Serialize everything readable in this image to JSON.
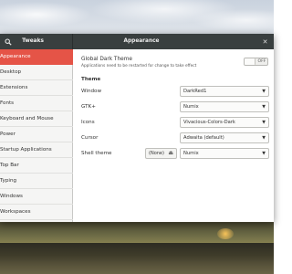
{
  "header": {
    "app_title": "Tweaks",
    "page_title": "Appearance",
    "icons": {
      "search": "search-icon",
      "close": "close-icon"
    }
  },
  "sidebar": {
    "items": [
      {
        "label": "Appearance",
        "active": true
      },
      {
        "label": "Desktop"
      },
      {
        "label": "Extensions"
      },
      {
        "label": "Fonts"
      },
      {
        "label": "Keyboard and Mouse"
      },
      {
        "label": "Power"
      },
      {
        "label": "Startup Applications"
      },
      {
        "label": "Top Bar"
      },
      {
        "label": "Typing"
      },
      {
        "label": "Windows"
      },
      {
        "label": "Workspaces"
      }
    ]
  },
  "main": {
    "global_dark": {
      "label": "Global Dark Theme",
      "note": "Applications need to be restarted for change to take effect",
      "toggle": "OFF"
    },
    "theme_heading": "Theme",
    "rows": [
      {
        "label": "Window",
        "value": "DarkRed1"
      },
      {
        "label": "GTK+",
        "value": "Numix"
      },
      {
        "label": "Icons",
        "value": "Vivacious-Colors-Dark"
      },
      {
        "label": "Cursor",
        "value": "Adwaita (default)"
      },
      {
        "label": "Shell theme",
        "value": "Numix",
        "extra_button": "(None)"
      }
    ]
  },
  "colors": {
    "accent": "#e55447",
    "header_bg": "#393f3f",
    "sidebar_bg": "#f5f5f4"
  }
}
